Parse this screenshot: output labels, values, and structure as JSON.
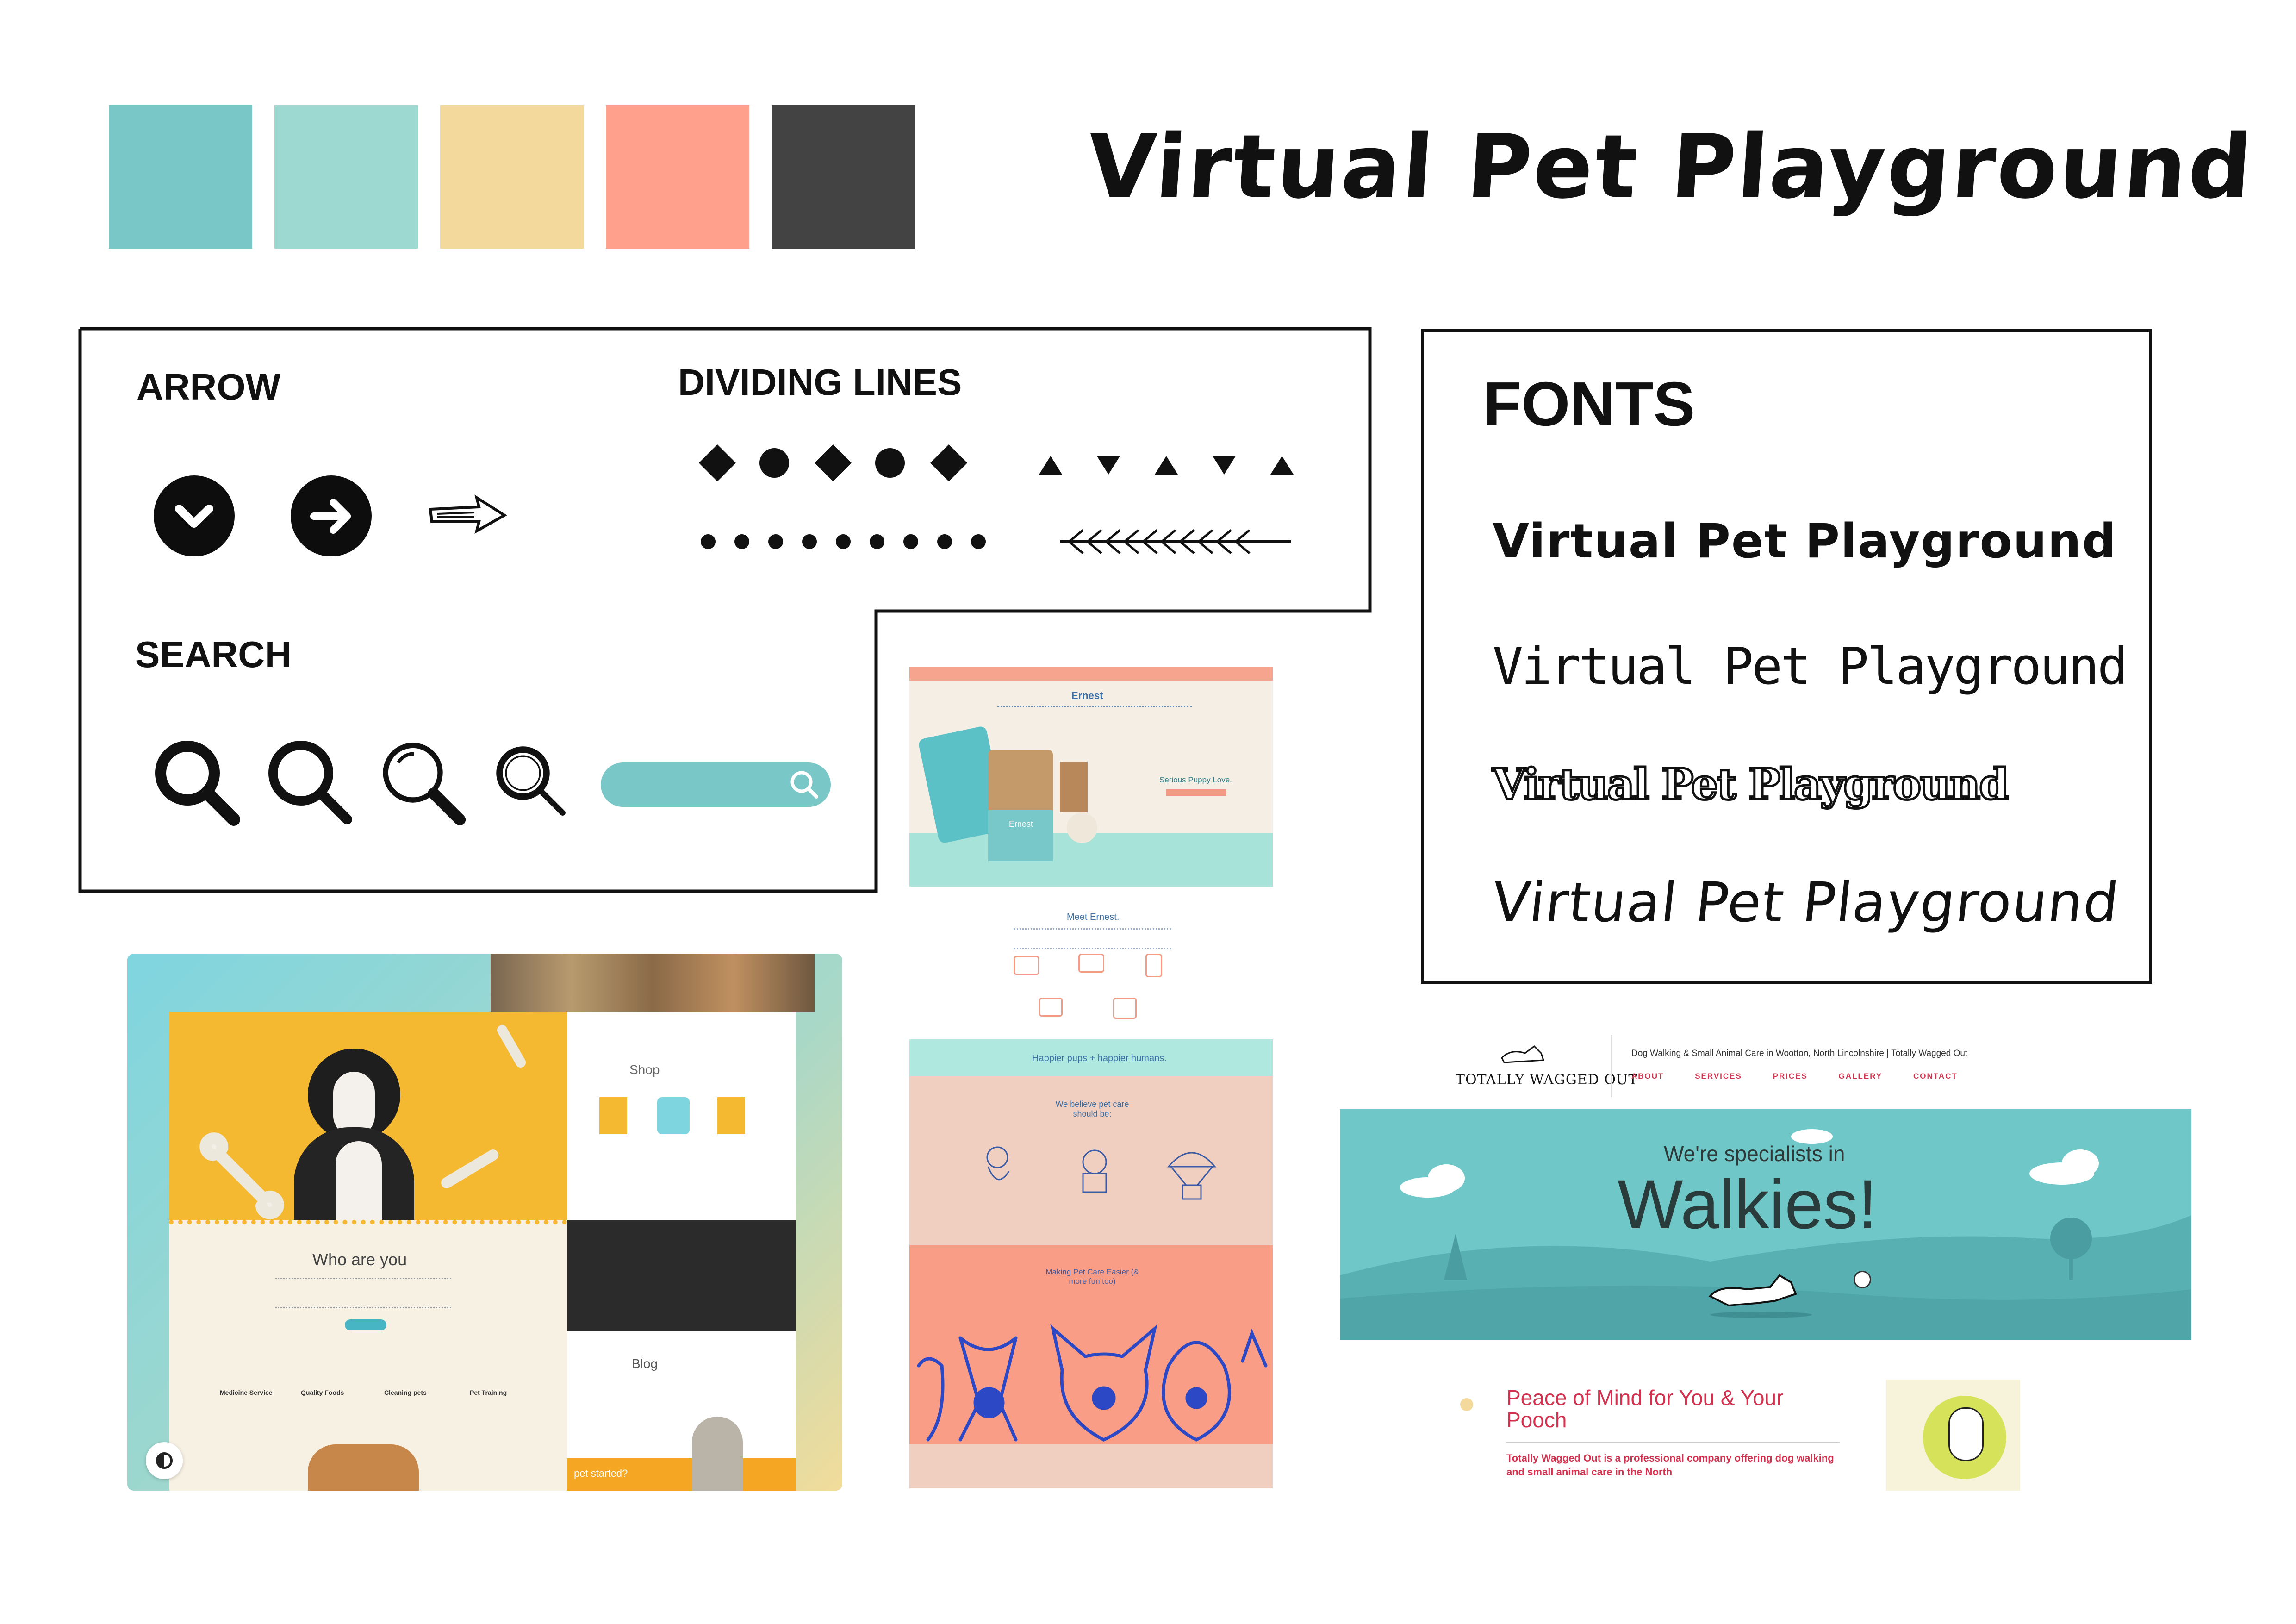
{
  "title": "Virtual Pet Playground",
  "palette": [
    "#79C7C6",
    "#9ED9D1",
    "#F3D99B",
    "#FFA08D",
    "#434343"
  ],
  "elements_panel": {
    "arrow_label": "ARROW",
    "dividing_lines_label": "DIVIDING LINES",
    "search_label": "SEARCH",
    "icons": [
      "chevron-down-circle-icon",
      "arrow-right-circle-icon",
      "sketch-arrow-icon",
      "magnifier-icon",
      "search-bar"
    ]
  },
  "fonts_panel": {
    "label": "FONTS",
    "samples": [
      "Virtual Pet Playground",
      "Virtual Pet Playground",
      "Virtual Pet Playground",
      "Virtual Pet Playground"
    ]
  },
  "ernest": {
    "logo": "Ernest",
    "hero_text": "Serious Puppy Love.",
    "meet": "Meet Ernest.",
    "pup_brand": "Ernest"
  },
  "pets_site": {
    "who": "Who are you",
    "shop": "Shop",
    "blog": "Blog",
    "services": [
      "Medicine Service",
      "Quality Foods",
      "Cleaning pets",
      "Pet Training"
    ],
    "cta": "pet started?"
  },
  "happier": {
    "banner": "Happier pups + happier humans.",
    "believe": "We believe pet care should be:",
    "making": "Making Pet Care Easier (& more fun too)"
  },
  "wagged": {
    "logo": "TOTALLY WAGGED OUT",
    "tagline": "Dog Walking & Small Animal Care in Wootton, North Lincolnshire | Totally Wagged Out",
    "nav": [
      "ABOUT",
      "SERVICES",
      "PRICES",
      "GALLERY",
      "CONTACT"
    ],
    "specialists": "We're specialists in",
    "walkies": "Walkies!",
    "peace": "Peace of Mind for You & Your Pooch",
    "body": "Totally Wagged Out is a professional company offering dog walking and small animal care in the North"
  }
}
